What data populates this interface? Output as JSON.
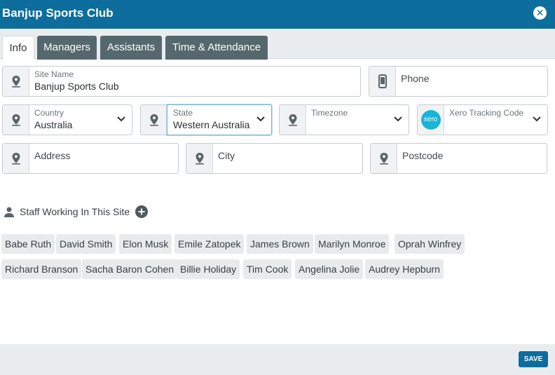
{
  "header": {
    "title": "Banjup Sports Club",
    "close_icon": "close-icon"
  },
  "tabs": [
    {
      "label": "Info",
      "active": true
    },
    {
      "label": "Managers",
      "active": false
    },
    {
      "label": "Assistants",
      "active": false
    },
    {
      "label": "Time & Attendance",
      "active": false
    }
  ],
  "fields": {
    "site_name": {
      "label": "Site Name",
      "value": "Banjup Sports Club"
    },
    "phone": {
      "label": "Phone",
      "value": ""
    },
    "country": {
      "label": "Country",
      "value": "Australia"
    },
    "state": {
      "label": "State",
      "value": "Western Australia"
    },
    "timezone": {
      "label": "Timezone",
      "value": ""
    },
    "xero": {
      "label": "Xero Tracking Code",
      "value": "",
      "logo_text": "xero"
    },
    "address": {
      "label": "Address",
      "value": ""
    },
    "city": {
      "label": "City",
      "value": ""
    },
    "postcode": {
      "label": "Postcode",
      "value": ""
    }
  },
  "staff": {
    "heading": "Staff Working In This Site",
    "members": [
      "Babe Ruth",
      "David Smith",
      "Elon Musk",
      "Emile Zatopek",
      "James Brown",
      "Marilyn Monroe",
      "Oprah Winfrey",
      "Richard Branson",
      "Sacha Baron Cohen",
      "Billie Holiday",
      "Tim Cook",
      "Angelina Jolie",
      "Audrey Hepburn"
    ]
  },
  "footer": {
    "save_label": "SAVE"
  },
  "colors": {
    "header": "#0d6d9d",
    "tab_inactive": "#55686d",
    "xero": "#1ab4d7",
    "chip": "#e8eaec"
  }
}
